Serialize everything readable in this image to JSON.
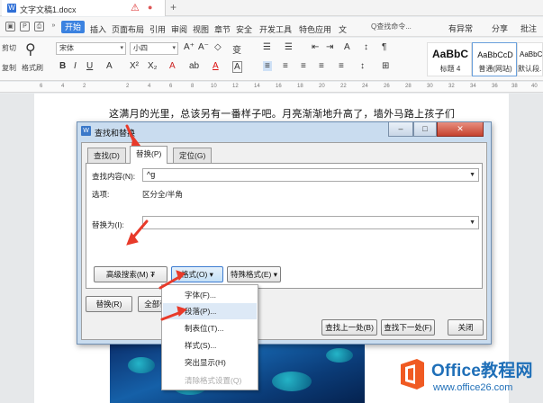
{
  "titlebar": {
    "filename": "文字文稿1.docx",
    "warn_icon": "warning-icon",
    "new_tab": "+"
  },
  "menubar": {
    "start": "开始",
    "items": [
      "插入",
      "页面布局",
      "引用",
      "审阅",
      "视图",
      "章节",
      "安全",
      "开发工具",
      "特色应用",
      "文"
    ],
    "search": "Q查找命令...",
    "right": [
      "有异常",
      "分享",
      "批注"
    ]
  },
  "ribbon": {
    "cut": "剪切",
    "paste_label": "格式刷",
    "copy": "复制",
    "font_name": "宋体",
    "font_size": "小四",
    "styles": [
      {
        "sample": "AaBbC",
        "name": "标题 4"
      },
      {
        "sample": "AaBbCcD",
        "name": "普通(网站)"
      },
      {
        "sample": "AaBbCc",
        "name": "默认段..."
      }
    ]
  },
  "ruler": {
    "ticks": [
      "6",
      "4",
      "2",
      "2",
      "4",
      "6",
      "8",
      "10",
      "12",
      "14",
      "16",
      "18",
      "20",
      "22",
      "24",
      "26",
      "28",
      "30",
      "32",
      "34",
      "36",
      "38",
      "40"
    ]
  },
  "document": {
    "text": "这满月的光里，总该另有一番样子吧。月亮渐渐地升高了，墙外马路上孩子们"
  },
  "dialog": {
    "title": "查找和替换",
    "tabs": [
      "查找(D)",
      "替换(P)",
      "定位(G)"
    ],
    "active_tab": 1,
    "find_label": "查找内容(N):",
    "find_value": "^g",
    "options_label": "选项:",
    "options_value": "区分全/半角",
    "replace_label": "替换为(I):",
    "replace_value": "",
    "buttons": {
      "advanced": "高级搜索(M) ₮",
      "format": "格式(O) ▾",
      "special": "特殊格式(E) ▾",
      "replace": "替换(R)",
      "replace_all": "全部替",
      "find_prev": "查找上一处(B)",
      "find_next": "查找下一处(F)",
      "close": "关闭"
    }
  },
  "format_menu": {
    "items": [
      "字体(F)...",
      "段落(P)...",
      "制表位(T)...",
      "样式(S)...",
      "突出显示(H)",
      "清除格式设置(Q)"
    ],
    "hover_index": 1,
    "disabled_index": 5
  },
  "watermark": {
    "title": "Office教程网",
    "url": "www.office26.com"
  },
  "colors": {
    "accent": "#3b82e0",
    "arrow": "#e83a2a",
    "dialog_frame": "#c9dcef",
    "watermark": "#1f6fb8",
    "logo_orange": "#f05a22"
  }
}
